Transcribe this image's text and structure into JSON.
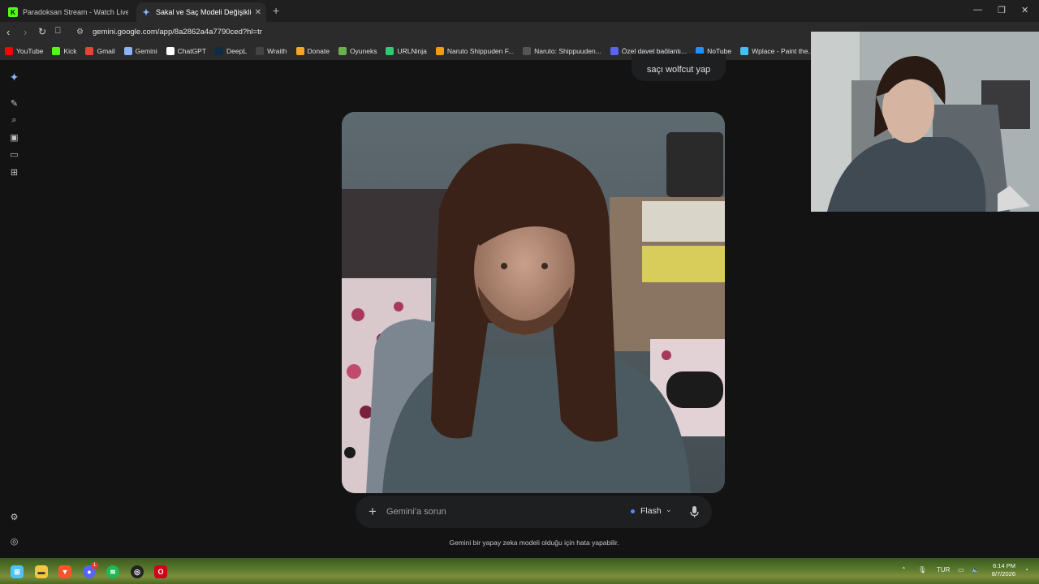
{
  "browser": {
    "tabs": [
      {
        "title": "Paradoksan Stream - Watch Live on K",
        "favicon": "kick-icon"
      },
      {
        "title": "Sakal ve Saç Modeli Değişikliği",
        "favicon": "gemini-icon",
        "active": true
      }
    ],
    "url": "gemini.google.com/app/8a2862a4a7790ced?hl=tr",
    "bookmarks": [
      {
        "label": "YouTube",
        "icon": "youtube-icon",
        "color": "#ff0000"
      },
      {
        "label": "Kick",
        "icon": "kick-icon",
        "color": "#53fc18"
      },
      {
        "label": "Gmail",
        "icon": "gmail-icon",
        "color": "#ea4335"
      },
      {
        "label": "Gemini",
        "icon": "gemini-icon",
        "color": "#8ab4f8"
      },
      {
        "label": "ChatGPT",
        "icon": "chatgpt-icon",
        "color": "#ffffff"
      },
      {
        "label": "DeepL",
        "icon": "deepl-icon",
        "color": "#0f2b46"
      },
      {
        "label": "Wraith",
        "icon": "wraith-icon",
        "color": "#444444"
      },
      {
        "label": "Donate",
        "icon": "donate-icon",
        "color": "#f5a623"
      },
      {
        "label": "Oyuneks",
        "icon": "oyuneks-icon",
        "color": "#6ab04c"
      },
      {
        "label": "URLNinja",
        "icon": "urlninja-icon",
        "color": "#2ecc71"
      },
      {
        "label": "Naruto Shippuden F...",
        "icon": "naruto-icon",
        "color": "#f39c12"
      },
      {
        "label": "Naruto: Shippuuden...",
        "icon": "naruto2-icon",
        "color": "#555555"
      },
      {
        "label": "Özel davet bağlantı...",
        "icon": "discord-icon",
        "color": "#5865f2"
      },
      {
        "label": "NoTube",
        "icon": "notube-icon",
        "color": "#1e90ff"
      },
      {
        "label": "Wplace - Paint the...",
        "icon": "wplace-icon",
        "color": "#3ec1f3"
      }
    ]
  },
  "gemini": {
    "user_prompt": "saçı wolfcut yap",
    "composer_placeholder": "Gemini'a sorun",
    "model_label": "Flash",
    "disclaimer": "Gemini bir yapay zeka modeli olduğu için hata yapabilir."
  },
  "taskbar": {
    "language": "TUR",
    "time": "6:14 PM",
    "date": "8/7/2026",
    "discord_badge": "1"
  },
  "colors": {
    "background": "#131314",
    "surface": "#1e1f20",
    "accent_blue": "#4c8df6"
  }
}
